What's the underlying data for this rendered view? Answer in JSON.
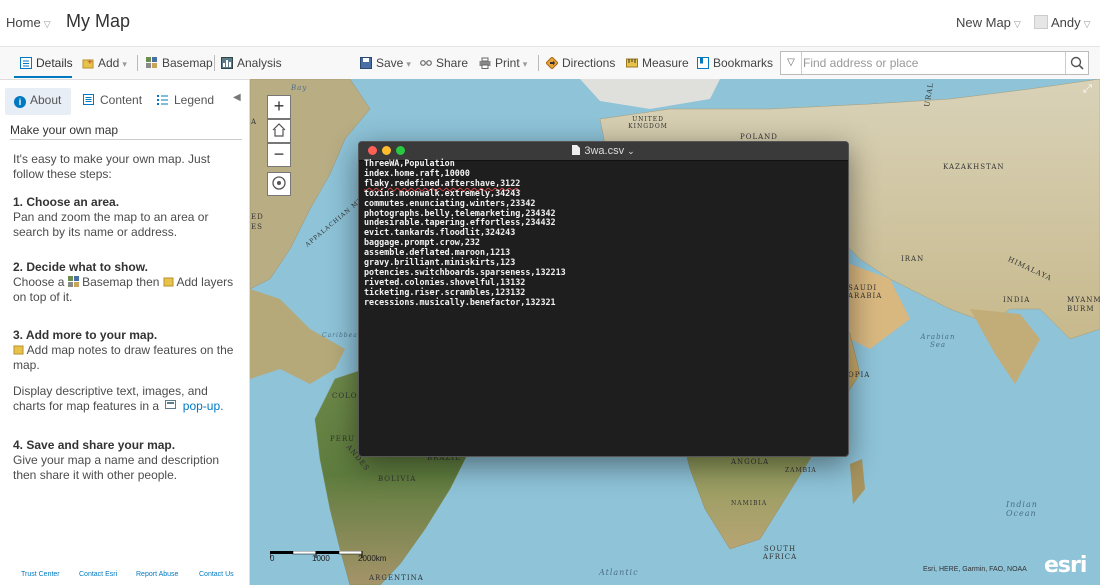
{
  "header": {
    "home_label": "Home",
    "map_title": "My Map",
    "new_map_label": "New Map",
    "user_name": "Andy"
  },
  "toolbar": {
    "details": "Details",
    "add": "Add",
    "basemap": "Basemap",
    "analysis": "Analysis",
    "save": "Save",
    "share": "Share",
    "print": "Print",
    "directions": "Directions",
    "measure": "Measure",
    "bookmarks": "Bookmarks",
    "search_placeholder": "Find address or place"
  },
  "panel": {
    "tabs": {
      "about": "About",
      "content": "Content",
      "legend": "Legend"
    },
    "heading": "Make your own map",
    "intro": "It's easy to make your own map. Just follow these steps:",
    "steps": [
      {
        "title": "1. Choose an area.",
        "text": "Pan and zoom the map to an area or search by its name or address."
      },
      {
        "title": "2. Decide what to show.",
        "text_a": "Choose a",
        "text_b": "Basemap then",
        "text_c": "Add layers on top of it."
      },
      {
        "title": "3. Add more to your map.",
        "text": "Add map notes to draw features on the map.",
        "text2": "Display descriptive text, images, and charts for map features in a",
        "link": "pop-up."
      },
      {
        "title": "4. Save and share your map.",
        "text": "Give your map a name and description then share it with other people."
      }
    ],
    "footer": [
      "Trust Center",
      "Contact Esri",
      "Report Abuse",
      "Contact Us"
    ]
  },
  "map": {
    "scale": {
      "ticks": [
        "0",
        "1000",
        "2000km"
      ]
    },
    "attribution": "Esri, HERE, Garmin, FAO, NOAA",
    "logo": "esri",
    "labels": {
      "bay": "Bay",
      "uk": "UNITED KINGDOM",
      "poland": "POLAND",
      "kazakhstan": "KAZAKHSTAN",
      "iran": "IRAN",
      "saudi": "SAUDI ARABIA",
      "india": "INDIA",
      "himalaya": "HIMALAYA",
      "arabian": "Arabian Sea",
      "ethiopia": "OPIA",
      "angola": "ANGOLA",
      "zambia": "ZAMBIA",
      "namibia": "NAMIBIA",
      "south_africa": "SOUTH AFRICA",
      "indian_ocean": "Indian Ocean",
      "brazil": "BRAZIL",
      "bolivia": "BOLIVIA",
      "peru": "PERU",
      "colombia": "COLO",
      "argentina": "ARGENTINA",
      "atlantic": "Atlantic",
      "caribbean": "Caribbean",
      "appalachian": "APPALACHIAN MT",
      "andes": "ANDES",
      "ural": "URAL M",
      "myanmar": "MYANM BURM",
      "left_edge_a": "A",
      "left_edge_b": "ED ES"
    }
  },
  "terminal": {
    "filename": "3wa.csv",
    "lines": [
      "ThreeWA,Population",
      "index.home.raft,10000",
      "flaky.redefined.aftershave,3122",
      "toxins.moonwalk.extremely,34243",
      "commutes.enunciating.winters,23342",
      "photographs.belly.telemarketing,234342",
      "undesirable.tapering.effortless,234432",
      "evict.tankards.floodlit,324243",
      "baggage.prompt.crow,232",
      "assemble.deflated.maroon,1213",
      "gravy.brilliant.miniskirts,123",
      "potencies.switchboards.sparseness,132213",
      "riveted.colonies.shovelful,13132",
      "ticketing.riser.scrambles,123132",
      "recessions.musically.benefactor,132321"
    ]
  },
  "colors": {
    "accent": "#0079c1",
    "ocean": "#8ec3d8",
    "terminal_bg": "#1e1e1e"
  }
}
